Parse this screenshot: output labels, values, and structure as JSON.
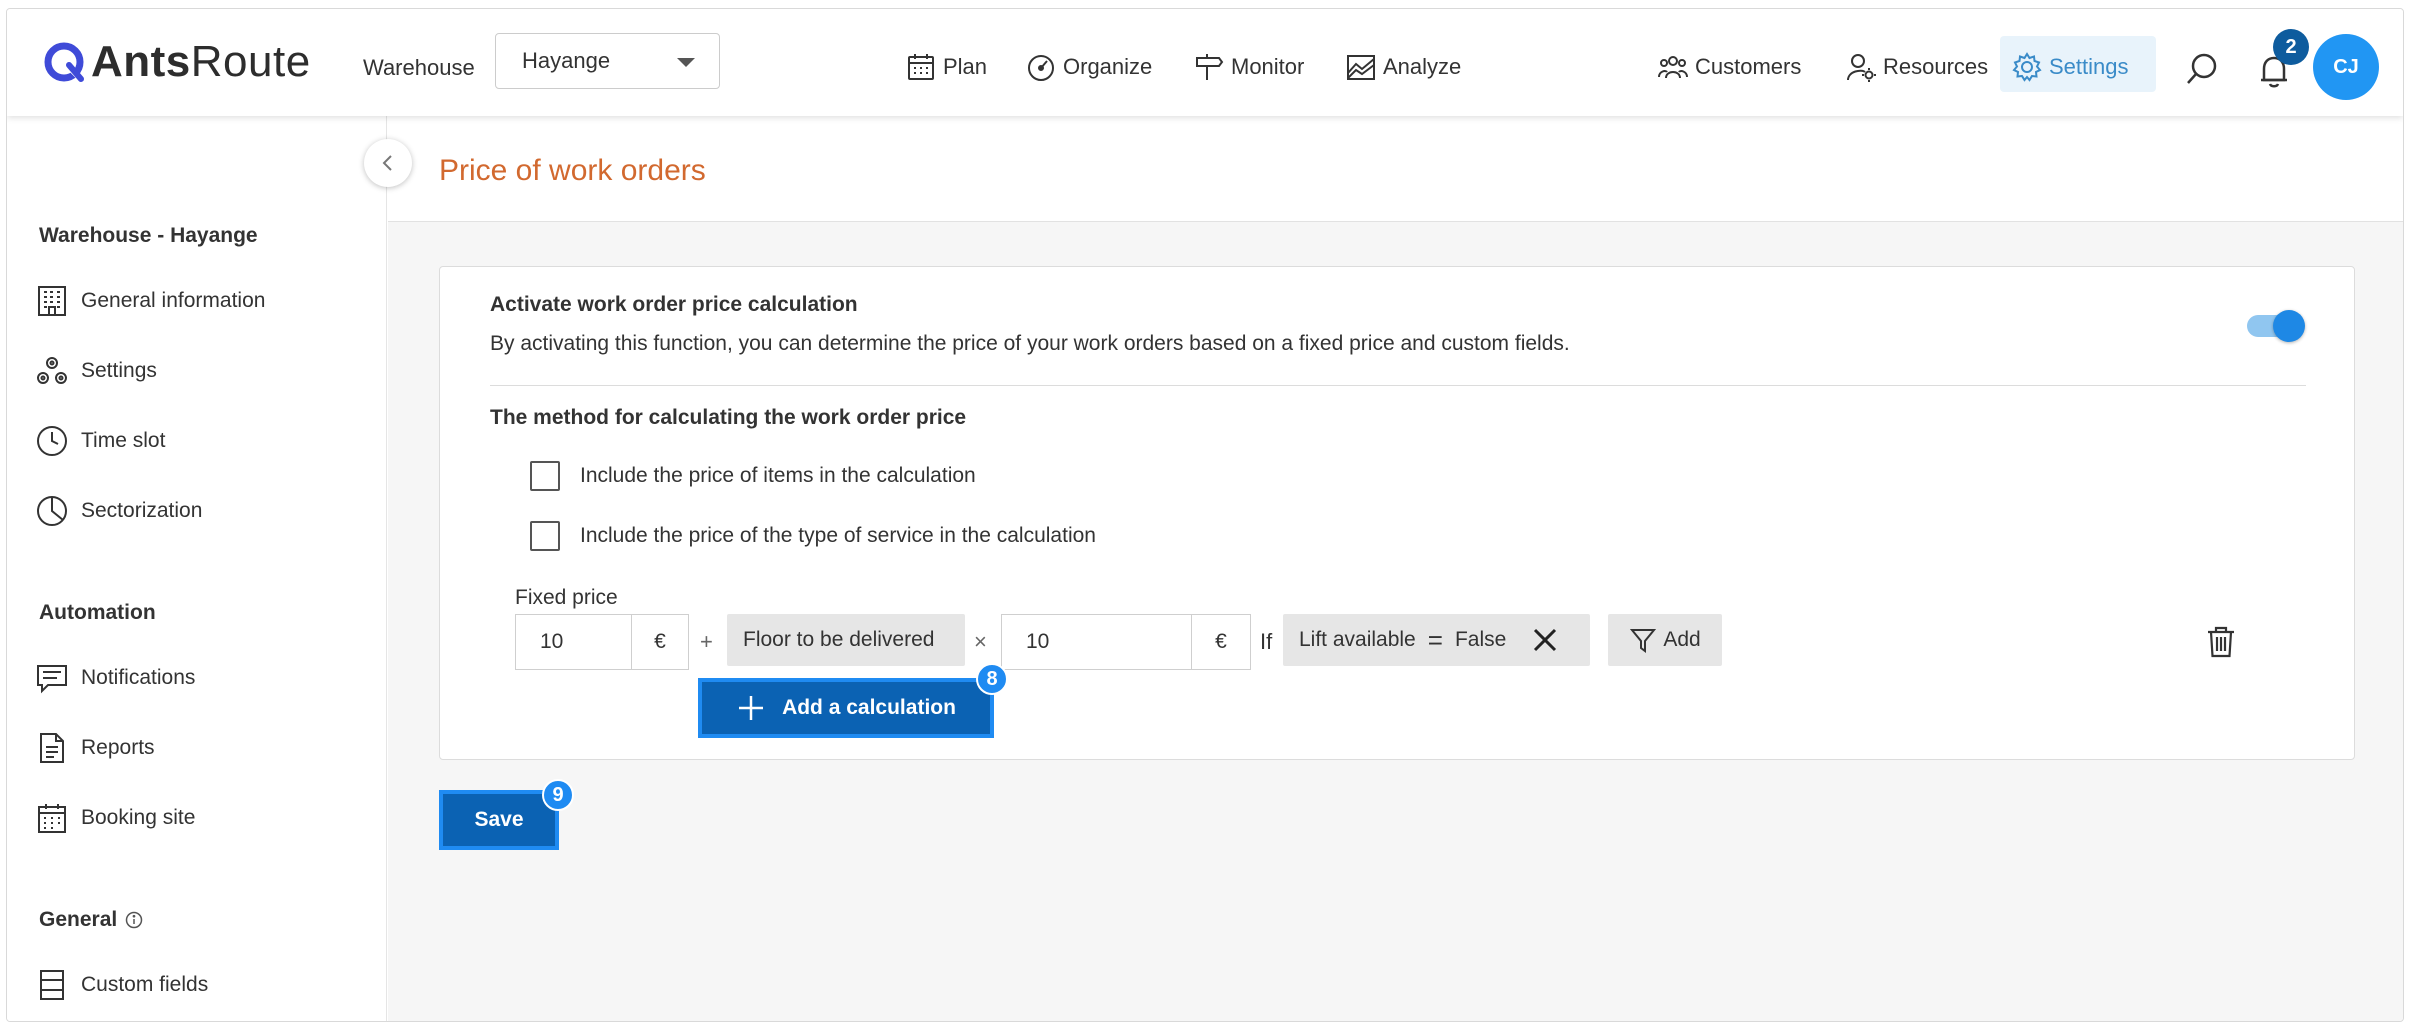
{
  "app": {
    "logo_text_bold": "Ants",
    "logo_text_regular": "Route"
  },
  "header": {
    "warehouse_label": "Warehouse",
    "warehouse_selected": "Hayange",
    "nav": [
      "Plan",
      "Organize",
      "Monitor",
      "Analyze"
    ],
    "right_nav": [
      "Customers",
      "Resources",
      "Settings"
    ],
    "notification_count": "2",
    "avatar_initials": "CJ"
  },
  "sidebar": {
    "section1_title": "Warehouse - Hayange",
    "section1_items": [
      "General information",
      "Settings",
      "Time slot",
      "Sectorization"
    ],
    "section2_title": "Automation",
    "section2_items": [
      "Notifications",
      "Reports",
      "Booking site"
    ],
    "section3_title": "General",
    "section3_items": [
      "Custom fields"
    ]
  },
  "page": {
    "title": "Price of work orders"
  },
  "card": {
    "activate_title": "Activate work order price calculation",
    "activate_desc": "By activating this function, you can determine the price of your work orders based on a fixed price and custom fields.",
    "toggle_on": true,
    "method_title": "The method for calculating the work order price",
    "checkbox_items": "Include the price of items in the calculation",
    "checkbox_service": "Include the price of the type of service in the calculation",
    "fixed_price_label": "Fixed price",
    "fixed_price_value": "10",
    "currency": "€",
    "plus": "+",
    "field_chip": "Floor to be delivered",
    "times": "×",
    "multiplier_value": "10",
    "if_label": "If",
    "condition_field": "Lift available",
    "condition_op": "=",
    "condition_value": "False",
    "add_filter_label": "Add",
    "add_calc_label": "Add a calculation",
    "add_calc_badge": "8"
  },
  "save": {
    "label": "Save",
    "badge": "9"
  },
  "colors": {
    "accent": "#0b62b3",
    "highlight": "#1f8bf2",
    "title_orange": "#d2692f",
    "settings_blue": "#3a8bc8"
  }
}
